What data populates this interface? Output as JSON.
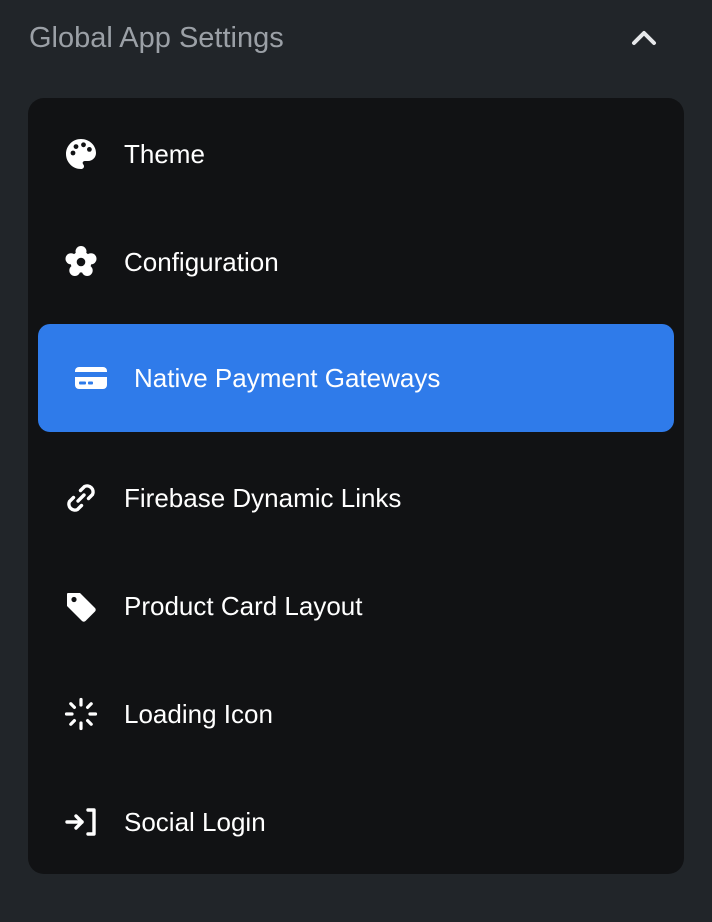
{
  "section": {
    "title": "Global App Settings",
    "collapse_icon": "chevron-up-icon"
  },
  "menu": {
    "items": [
      {
        "label": "Theme",
        "icon": "palette-icon",
        "active": false
      },
      {
        "label": "Configuration",
        "icon": "gear-icon",
        "active": false
      },
      {
        "label": "Native Payment Gateways",
        "icon": "credit-card-icon",
        "active": true
      },
      {
        "label": "Firebase Dynamic Links",
        "icon": "link-icon",
        "active": false
      },
      {
        "label": "Product Card Layout",
        "icon": "tag-icon",
        "active": false
      },
      {
        "label": "Loading Icon",
        "icon": "loading-spinner-icon",
        "active": false
      },
      {
        "label": "Social Login",
        "icon": "sign-in-icon",
        "active": false
      }
    ]
  },
  "colors": {
    "background": "#212529",
    "panel": "#111214",
    "active": "#2f7bea",
    "header_text": "#9ba0a6",
    "item_text": "#ffffff"
  }
}
